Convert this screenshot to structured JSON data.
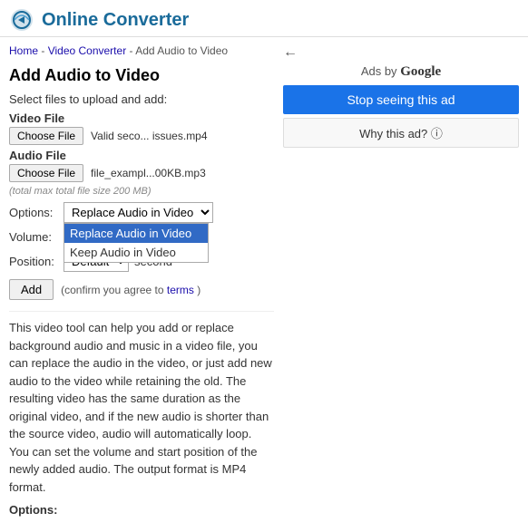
{
  "header": {
    "title": "Online Converter"
  },
  "breadcrumb": {
    "home": "Home",
    "separator1": " - ",
    "video_converter": "Video Converter",
    "separator2": " - ",
    "current": "Add Audio to Video"
  },
  "page": {
    "title": "Add Audio to Video",
    "select_files_label": "Select files to upload and add:",
    "video_file_label": "Video File",
    "audio_file_label": "Audio File",
    "choose_file_label": "Choose File",
    "video_filename": "Valid seco... issues.mp4",
    "audio_filename": "file_exampl...00KB.mp3",
    "file_size_note": "(total max total file size 200 MB)",
    "options_label": "Options:",
    "options_select_value": "Replace Audio in Video",
    "options_items": [
      "Replace Audio in Video",
      "Keep Audio in Video"
    ],
    "volume_label": "Volume:",
    "volume_value": "",
    "position_label": "Position:",
    "position_select_value": "Default",
    "position_options": [
      "Default"
    ],
    "position_unit": "second",
    "add_button": "Add",
    "terms_note": "(confirm you agree to",
    "terms_link": "terms",
    "terms_close": ")",
    "description": "This video tool can help you add or replace background audio and music in a video file, you can replace the audio in the video, or just add new audio to the video while retaining the old. The resulting video has the same duration as the original video, and if the new audio is shorter than the source video, audio will automatically loop. You can set the volume and start position of the newly added audio. The output format is MP4 format.",
    "options_footer_label": "Options:"
  },
  "ad": {
    "back_arrow": "←",
    "ads_by_label": "Ads by",
    "google_label": "Google",
    "stop_ad_button": "Stop seeing this ad",
    "why_ad_button": "Why this ad? ⓘ"
  }
}
